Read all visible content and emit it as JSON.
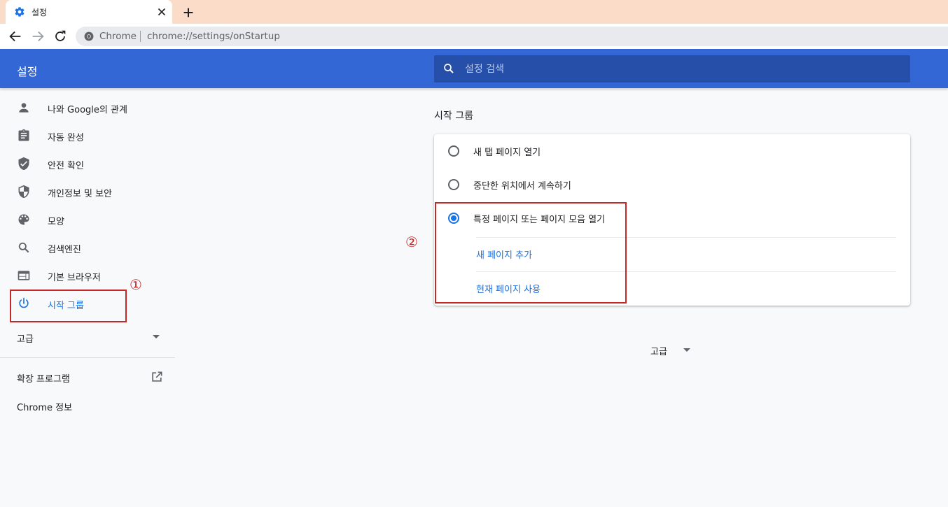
{
  "browser": {
    "tab_title": "설정",
    "omnibox_chip": "Chrome",
    "url": "chrome://settings/onStartup",
    "colors": {
      "tabstrip": "#fbdcc8"
    }
  },
  "header": {
    "title": "설정",
    "search_placeholder": "설정 검색",
    "color": "#3367d6"
  },
  "sidebar": {
    "items": [
      {
        "label": "나와 Google의 관계",
        "icon": "person-icon"
      },
      {
        "label": "자동 완성",
        "icon": "clipboard-icon"
      },
      {
        "label": "안전 확인",
        "icon": "shield-check-icon"
      },
      {
        "label": "개인정보 및 보안",
        "icon": "shield-half-icon"
      },
      {
        "label": "모양",
        "icon": "palette-icon"
      },
      {
        "label": "검색엔진",
        "icon": "search-icon"
      },
      {
        "label": "기본 브라우저",
        "icon": "browser-window-icon"
      },
      {
        "label": "시작 그룹",
        "icon": "power-icon",
        "selected": true
      }
    ],
    "advanced_label": "고급",
    "extensions_label": "확장 프로그램",
    "about_label": "Chrome 정보"
  },
  "main": {
    "section_title": "시작 그룹",
    "options": [
      {
        "label": "새 탭 페이지 열기",
        "checked": false
      },
      {
        "label": "중단한 위치에서 계속하기",
        "checked": false
      },
      {
        "label": "특정 페이지 또는 페이지 모음 열기",
        "checked": true
      }
    ],
    "add_page_label": "새 페이지 추가",
    "use_current_label": "현재 페이지 사용",
    "advanced_label": "고급"
  },
  "annotations": {
    "marker1": "①",
    "marker2": "②",
    "color": "#c62828"
  }
}
